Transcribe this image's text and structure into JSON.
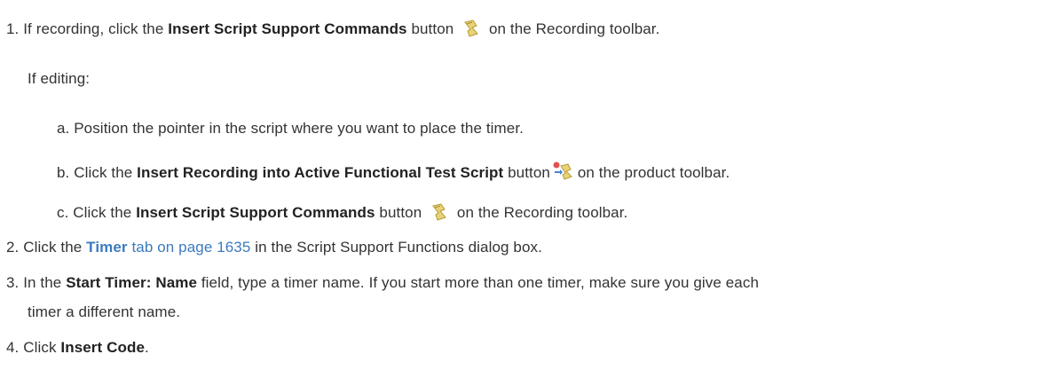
{
  "steps": {
    "s1": {
      "num": "1.",
      "pre": "If recording, click the",
      "bold": "Insert Script Support Commands",
      "mid": "button",
      "post": "on the Recording toolbar.",
      "icon": "script-support-icon"
    },
    "editing": "If editing:",
    "a": {
      "letter": "a.",
      "text": "Position the pointer in the script where you want to place the timer."
    },
    "b": {
      "letter": "b.",
      "pre": "Click the",
      "bold": "Insert Recording into Active Functional Test Script",
      "mid": "button",
      "post": "on the product toolbar.",
      "icon": "insert-recording-icon"
    },
    "c": {
      "letter": "c.",
      "pre": "Click the",
      "bold": "Insert Script Support Commands",
      "mid": "button",
      "post": "on the Recording toolbar.",
      "icon": "script-support-icon"
    },
    "s2": {
      "num": "2.",
      "pre": "Click the",
      "link_bold": "Timer",
      "link_rest": "tab on page 1635",
      "post": "in the Script Support Functions dialog box."
    },
    "s3": {
      "num": "3.",
      "pre": "In the",
      "bold": "Start Timer: Name",
      "post": "field, type a timer name. If you start more than one timer, make sure you give each",
      "cont": "timer a different name."
    },
    "s4": {
      "num": "4.",
      "pre": "Click",
      "bold": "Insert Code",
      "post": "."
    }
  }
}
